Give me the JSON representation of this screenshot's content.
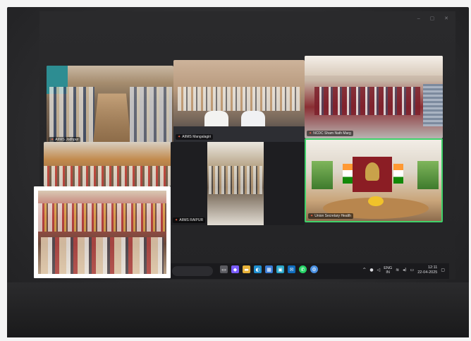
{
  "tiles": [
    {
      "id": "t1",
      "label": "AIIMS Jodhpur"
    },
    {
      "id": "t2",
      "label": "AIIMS Mangalagiri"
    },
    {
      "id": "t3",
      "label": "NCDC Sham Nath Marg"
    },
    {
      "id": "t4",
      "label": ""
    },
    {
      "id": "t5",
      "label": "AIIMS RAIPUR"
    },
    {
      "id": "t6",
      "label": "Union Secretary Health"
    },
    {
      "id": "t7",
      "label": ""
    }
  ],
  "taskbar": {
    "search_placeholder": "Search",
    "icons": [
      {
        "name": "task-view-icon",
        "color": "#5a5a60"
      },
      {
        "name": "copilot-icon",
        "color": "#7a5cff"
      },
      {
        "name": "file-explorer-icon",
        "color": "#e8b23a"
      },
      {
        "name": "edge-browser-icon",
        "color": "#1f8fd0"
      },
      {
        "name": "store-icon",
        "color": "#3a7bd5"
      },
      {
        "name": "photos-icon",
        "color": "#2aa6c9"
      },
      {
        "name": "outlook-icon",
        "color": "#0f6cbd"
      },
      {
        "name": "whatsapp-icon",
        "color": "#25d366"
      },
      {
        "name": "settings-icon",
        "color": "#4a90e2"
      }
    ],
    "tray": {
      "language_top": "ENG",
      "language_bottom": "IN",
      "time": "12:11",
      "date": "22-04-2025"
    }
  }
}
